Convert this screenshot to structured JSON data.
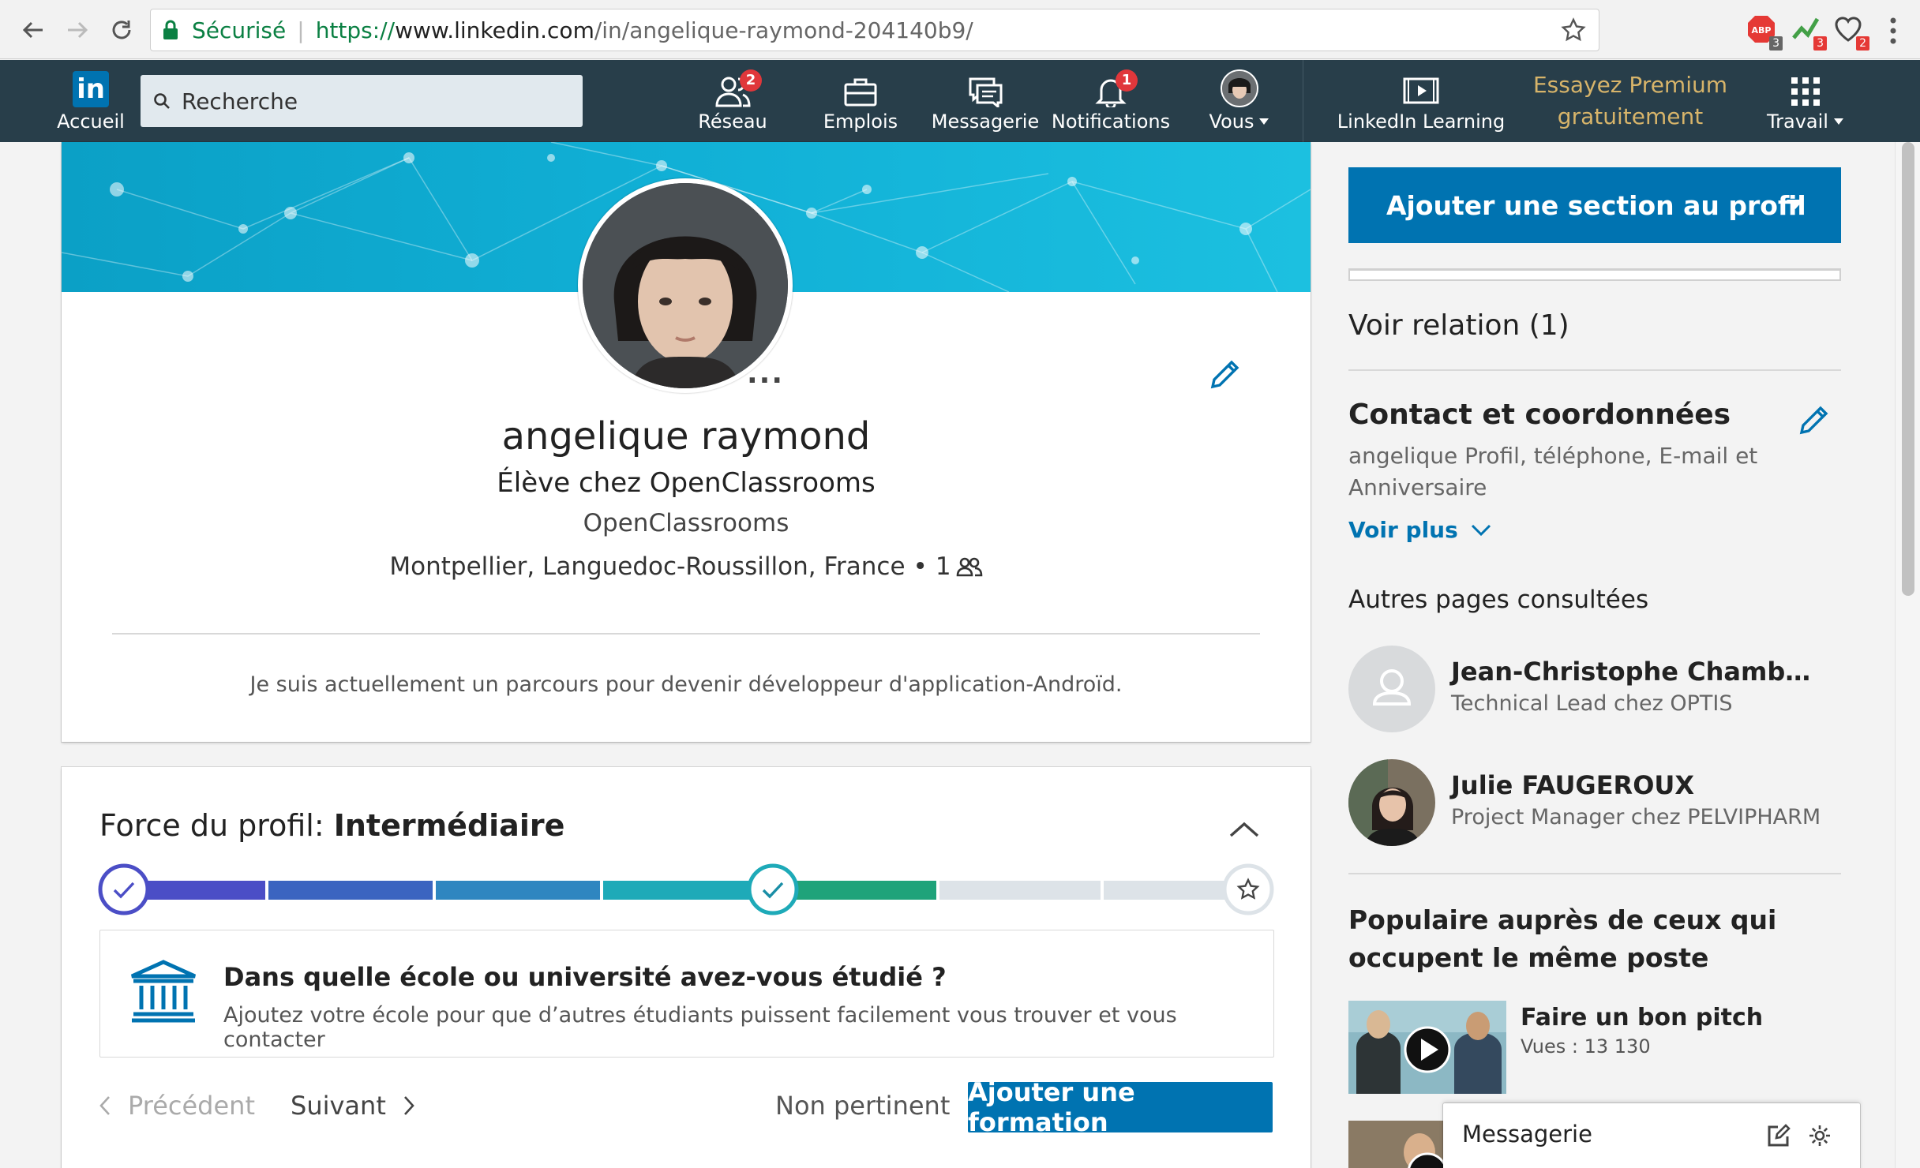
{
  "browser": {
    "secure_label": "Sécurisé",
    "url_protocol": "https://",
    "url_host": "www.linkedin.com",
    "url_path": "/in/angelique-raymond-204140b9/",
    "extensions": [
      {
        "name": "adblock-extension",
        "badge": "3",
        "color": "#e53935"
      },
      {
        "name": "green-extension",
        "badge": "3",
        "color": "#43a047"
      },
      {
        "name": "heart-extension",
        "badge": "2",
        "color": "#555555"
      }
    ]
  },
  "nav": {
    "logo": "in",
    "home_label": "Accueil",
    "search_placeholder": "Recherche",
    "items": [
      {
        "label": "Réseau",
        "badge": "2"
      },
      {
        "label": "Emplois"
      },
      {
        "label": "Messagerie"
      },
      {
        "label": "Notifications",
        "badge": "1"
      },
      {
        "label": "Vous"
      }
    ],
    "learning_label": "LinkedIn Learning",
    "premium_line1": "Essayez Premium",
    "premium_line2": "gratuitement",
    "work_label": "Travail"
  },
  "profile": {
    "name": "angelique raymond",
    "headline": "Élève chez OpenClassrooms",
    "company": "OpenClassrooms",
    "location": "Montpellier, Languedoc-Roussillon, France",
    "bullet": "•",
    "connections": "1",
    "more_label": "···",
    "summary": "Je suis actuellement un parcours pour devenir développeur d'application-Androïd."
  },
  "strength": {
    "title_prefix": "Force du profil: ",
    "level": "Intermédiaire",
    "progress_fraction": 0.57,
    "question": "Dans quelle école ou université avez-vous étudié ?",
    "hint": "Ajoutez votre école pour que d’autres étudiants puissent facilement vous trouver et vous contacter",
    "prev_label": "Précédent",
    "next_label": "Suivant",
    "not_relevant_label": "Non pertinent",
    "add_label": "Ajouter une formation"
  },
  "rail": {
    "add_section_label": "Ajouter une section au profil",
    "voir_relation": "Voir relation (1)",
    "contact_title": "Contact et coordonnées",
    "contact_desc": "angelique Profil, téléphone, E-mail et Anniversaire",
    "voir_plus": "Voir plus",
    "autres_title": "Autres pages consultées",
    "people": [
      {
        "name": "Jean-Christophe Chamb…",
        "title": "Technical Lead chez OPTIS"
      },
      {
        "name": "Julie FAUGEROUX",
        "title": "Project Manager chez PELVIPHARM"
      }
    ],
    "populaire_title": "Populaire auprès de ceux qui occupent le même poste",
    "course_title": "Faire un bon pitch",
    "course_views": "Vues : 13 130"
  },
  "messaging": {
    "label": "Messagerie"
  },
  "colors": {
    "nav_bg": "#283e4a",
    "accent_blue": "#0073b1",
    "premium_gold": "#d7b46a",
    "badge_red": "#e0373b"
  }
}
